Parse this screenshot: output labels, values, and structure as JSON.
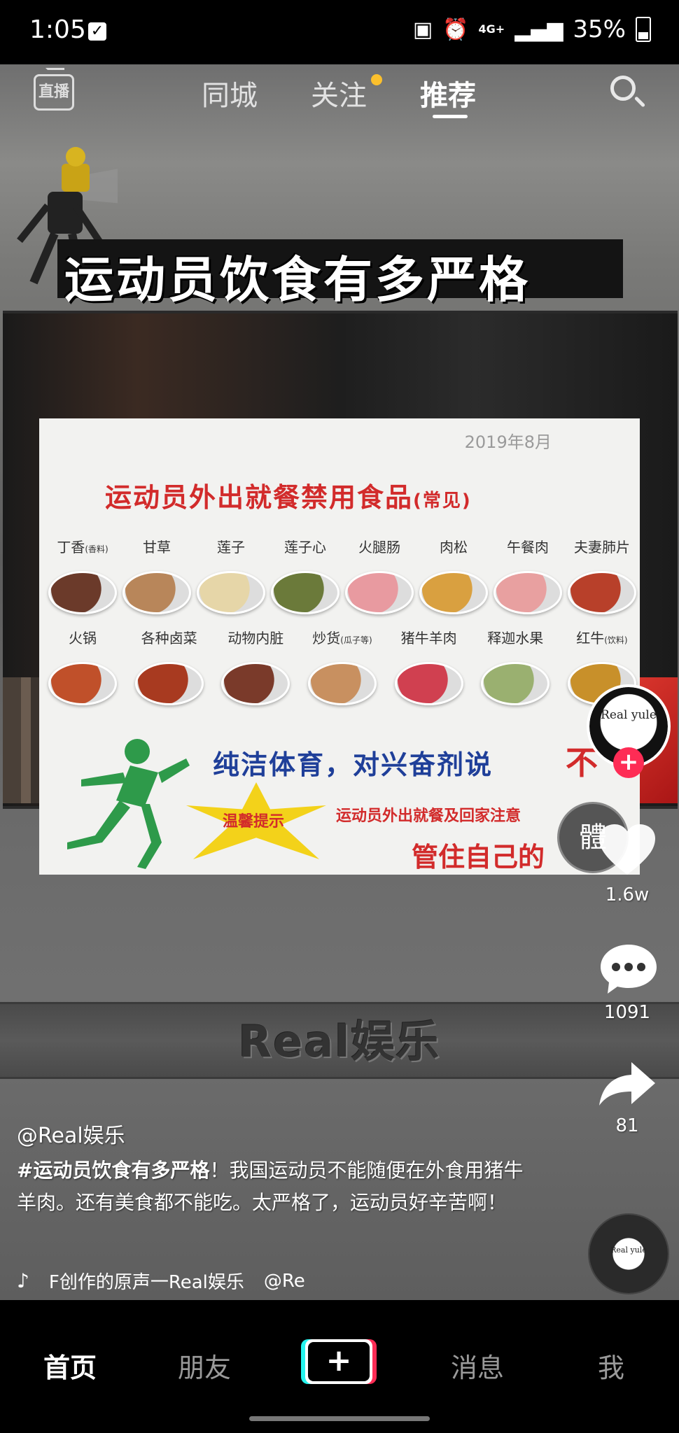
{
  "status_bar": {
    "time": "1:05",
    "network": "4G+",
    "battery": "35%"
  },
  "top_nav": {
    "live_label": "直播",
    "tabs": [
      "同城",
      "关注",
      "推荐"
    ],
    "active_tab": "推荐"
  },
  "video": {
    "title": "运动员饮食有多严格",
    "watermark": "Real娱乐",
    "poster": {
      "date": "2019年8月",
      "title_main": "运动员外出就餐禁用食品",
      "title_sub": "(常见)",
      "row1": [
        {
          "label": "丁香",
          "note": "(香料)",
          "color": "#6b3a2a"
        },
        {
          "label": "甘草",
          "note": "",
          "color": "#b8865a"
        },
        {
          "label": "莲子",
          "note": "",
          "color": "#e6d6a8"
        },
        {
          "label": "莲子心",
          "note": "",
          "color": "#6b7a3a"
        },
        {
          "label": "火腿肠",
          "note": "",
          "color": "#e89aa0"
        },
        {
          "label": "肉松",
          "note": "",
          "color": "#d9a040"
        },
        {
          "label": "午餐肉",
          "note": "",
          "color": "#e8a0a0"
        },
        {
          "label": "夫妻肺片",
          "note": "",
          "color": "#b8402a"
        }
      ],
      "row2": [
        {
          "label": "火锅",
          "note": "",
          "color": "#c0502a"
        },
        {
          "label": "各种卤菜",
          "note": "",
          "color": "#a83a20"
        },
        {
          "label": "动物内脏",
          "note": "",
          "color": "#7a3a2a"
        },
        {
          "label": "炒货",
          "note": "(瓜子等)",
          "color": "#c89060"
        },
        {
          "label": "猪牛羊肉",
          "note": "",
          "color": "#d04050"
        },
        {
          "label": "释迦水果",
          "note": "",
          "color": "#9ab070"
        },
        {
          "label": "红牛",
          "note": "(饮料)",
          "color": "#c8902a"
        }
      ],
      "slogan": "纯洁体育，对兴奋剂说",
      "slogan_no": "不",
      "tip_label": "温馨提示",
      "tip_text": "运动员外出就餐及回家注意",
      "tip_bottom": "管住自己的",
      "logo": "體"
    }
  },
  "actions": {
    "avatar_text": "Real yule",
    "likes": "1.6w",
    "comments": "1091",
    "shares": "81"
  },
  "caption": {
    "author": "@Real娱乐",
    "hashtag": "#运动员饮食有多严格",
    "text": "！我国运动员不能随便在外食用猪牛羊肉。还有美食都不能吃。太严格了，运动员好辛苦啊！",
    "music": "F创作的原声一Real娱乐",
    "music_mention": "@Re"
  },
  "bottom_nav": {
    "items": [
      "首页",
      "朋友",
      "消息",
      "我"
    ],
    "active": "首页"
  },
  "colors": {
    "accent_red": "#fe2c55",
    "accent_cyan": "#25f4ee",
    "notify_dot": "#fbc02d"
  }
}
